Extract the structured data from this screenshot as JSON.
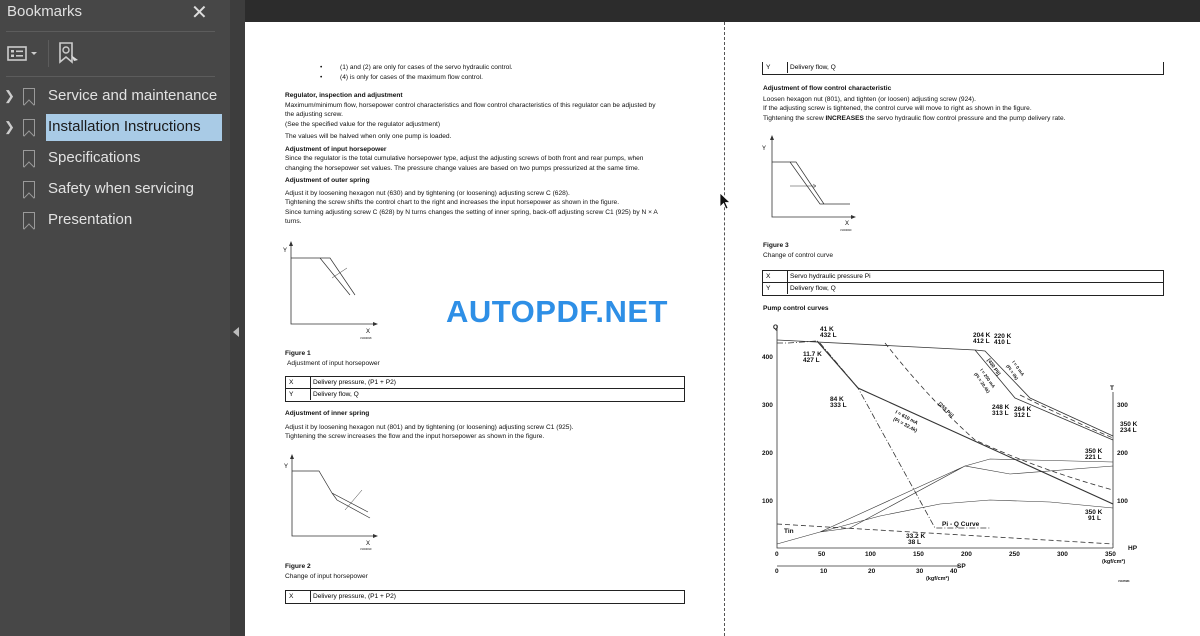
{
  "sidebar": {
    "title": "Bookmarks",
    "close_icon": "close-icon",
    "options_icon": "list-options-icon",
    "find_bookmark_icon": "bookmark-search-icon",
    "items": [
      {
        "label": "Service and maintenance",
        "expandable": true
      },
      {
        "label": "Installation Instructions",
        "expandable": true,
        "selected": true
      },
      {
        "label": "Specifications",
        "expandable": false
      },
      {
        "label": "Safety when servicing",
        "expandable": false
      },
      {
        "label": "Presentation",
        "expandable": false
      }
    ]
  },
  "watermark": "AUTOPDF.NET",
  "colors": {
    "selected": "#a9cbe6",
    "watermark": "#2e8fe6",
    "sidebar": "#474747"
  },
  "left_page": {
    "bullets": [
      "(1) and (2) are only for cases of the servo hydraulic control.",
      "(4) is only for cases of the maximum flow control."
    ],
    "h1": "Regulator, inspection and adjustment",
    "p1": [
      "Maximum/minimum flow, horsepower control characteristics and flow control characteristics of this regulator can be adjusted by",
      "the adjusting screw.",
      "(See the specified value for the regulator adjustment)"
    ],
    "p2": "The values will be halved when only one pump is loaded.",
    "h2": "Adjustment of input horsepower",
    "p3": [
      "Since the regulator is the total cumulative horsepower type, adjust the adjusting screws of both front and rear pumps, when",
      "changing the horsepower set values. The pressure change values are based on two pumps pressurized at the same time."
    ],
    "h3": "Adjustment of outer spring",
    "p4": [
      "Adjust it by loosening hexagon nut (630) and by tightening (or loosening) adjusting screw C (628).",
      "Tightening the screw shifts the control chart to the right and increases the input horsepower as shown in the figure.",
      "Since turning adjusting screw C (628) by N turns changes the setting of inner spring, back-off adjusting screw C1 (925) by N × A",
      "turns."
    ],
    "fig1": {
      "title": "Figure 1",
      "caption": "Adjustment of input horsepower",
      "x": "X",
      "y": "Y",
      "code": "V1004818",
      "rows": [
        [
          "X",
          "Delivery pressure, (P1 + P2)"
        ],
        [
          "Y",
          "Delivery flow, Q"
        ]
      ]
    },
    "h4": "Adjustment of inner spring",
    "p5": [
      "Adjust it by loosening hexagon nut (801) and by tightening (or loosening) adjusting screw C1 (925).",
      "Tightening the screw increases the flow and the input horsepower as shown in the figure."
    ],
    "fig2": {
      "title": "Figure 2",
      "caption": "Change of input horsepower",
      "x": "X",
      "y": "Y",
      "code": "V1004819",
      "rows": [
        [
          "X",
          "Delivery pressure, (P1 + P2)"
        ]
      ]
    }
  },
  "right_page": {
    "top_row": [
      "Y",
      "Delivery flow, Q"
    ],
    "h1": "Adjustment of flow control characteristic",
    "p1": [
      "Loosen hexagon nut (801), and tighten (or loosen) adjusting screw (924).",
      "If the adjusting screw is tightened, the control curve will move to right as shown in the figure.",
      "Tightening the screw INCREASES the servo hydraulic flow control pressure and the pump delivery rate."
    ],
    "fig3": {
      "title": "Figure 3",
      "caption": "Change of control curve",
      "x": "X",
      "y": "Y",
      "code": "V1004820",
      "rows": [
        [
          "X",
          "Servo hydraulic pressure Pi"
        ],
        [
          "Y",
          "Delivery flow, Q"
        ]
      ]
    },
    "h2": "Pump control curves",
    "pump_chart": {
      "q_label": "Q",
      "t_label": "T",
      "hp_label": "HP",
      "sp_label": "SP",
      "unit": "(kgf/cm²)",
      "code": "V1037983",
      "y_ticks": [
        "400",
        "300",
        "200",
        "100"
      ],
      "t_ticks": [
        "300",
        "200",
        "100"
      ],
      "x_ticks": [
        "0",
        "50",
        "100",
        "150",
        "200",
        "250",
        "300",
        "350"
      ],
      "sp_ticks": [
        "0",
        "10",
        "20",
        "30",
        "40"
      ],
      "points": [
        [
          "41 K",
          "432 L"
        ],
        [
          "11.7 K",
          "427 L"
        ],
        [
          "84 K",
          "333 L"
        ],
        [
          "204 K",
          "412 L"
        ],
        [
          "220 K",
          "410 L"
        ],
        [
          "248 K",
          "313 L"
        ],
        [
          "264 K",
          "312 L"
        ],
        [
          "350 K",
          "234 L"
        ],
        [
          "350 K",
          "221 L"
        ],
        [
          "350 K",
          "91 L"
        ],
        [
          "33.2 K",
          "38 L"
        ]
      ],
      "curve_labels": {
        "i610": "I = 610 mA",
        "pi324": "(Pi = 32.4k)",
        "p255": "[255 Pli]",
        "p430": "[430 Pli]",
        "i0": "I = 0 mA",
        "pi0": "(Pi = 0k)",
        "i200": "I = 200 mA",
        "pi20": "(Pi = 20.4k)",
        "piq": "Pi - Q Curve",
        "tin": "Tin"
      }
    }
  }
}
